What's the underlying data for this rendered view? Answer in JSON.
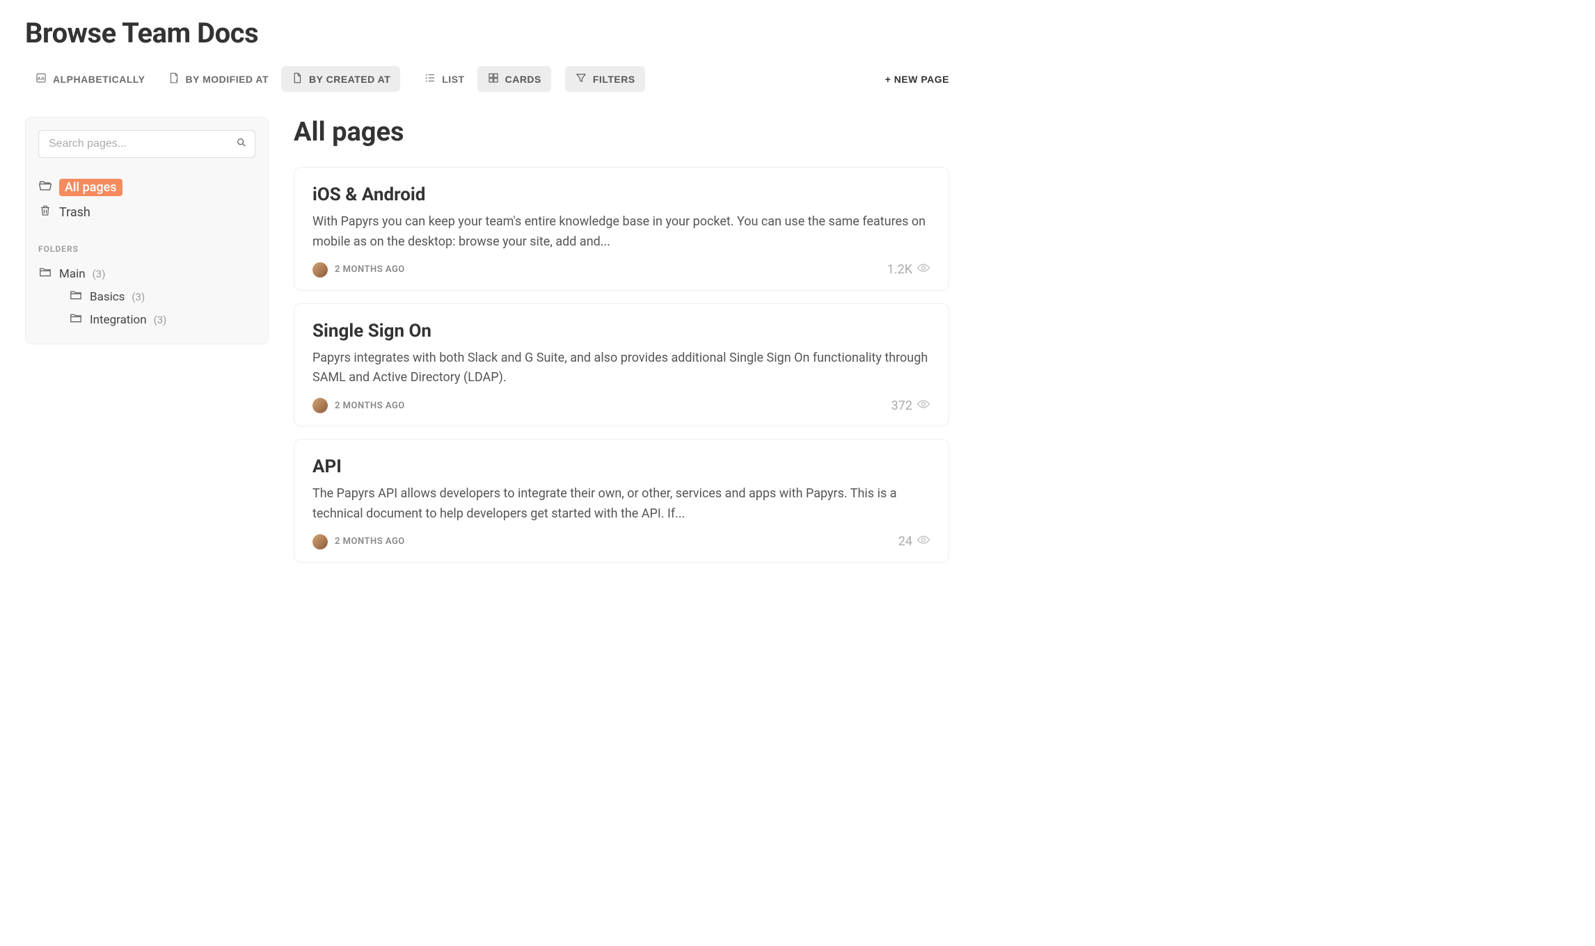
{
  "page_title": "Browse Team Docs",
  "toolbar": {
    "sort": {
      "alpha": "Alphabetically",
      "modified": "By Modified At",
      "created": "By Created At"
    },
    "view": {
      "list": "List",
      "cards": "Cards"
    },
    "filters": "Filters",
    "new_page": "+ New Page"
  },
  "sidebar": {
    "search_placeholder": "Search pages...",
    "all_pages": "All pages",
    "trash": "Trash",
    "folders_heading": "Folders",
    "folders": [
      {
        "name": "Main",
        "count": "(3)"
      },
      {
        "name": "Basics",
        "count": "(3)"
      },
      {
        "name": "Integration",
        "count": "(3)"
      }
    ]
  },
  "main": {
    "heading": "All pages",
    "cards": [
      {
        "title": "iOS & Android",
        "excerpt": "With Papyrs you can keep your team's entire knowledge base in your pocket. You can use the same features on mobile as on the desktop: browse your site, add and...",
        "date": "2 months ago",
        "views": "1.2K"
      },
      {
        "title": "Single Sign On",
        "excerpt": "Papyrs integrates with both Slack and G Suite, and also provides additional Single Sign On functionality through SAML and Active Directory (LDAP).",
        "date": "2 months ago",
        "views": "372"
      },
      {
        "title": "API",
        "excerpt": "The Papyrs API allows developers to integrate their own, or other, services and apps with Papyrs. This is a technical document to help developers get started with the API. If...",
        "date": "2 months ago",
        "views": "24"
      }
    ]
  }
}
